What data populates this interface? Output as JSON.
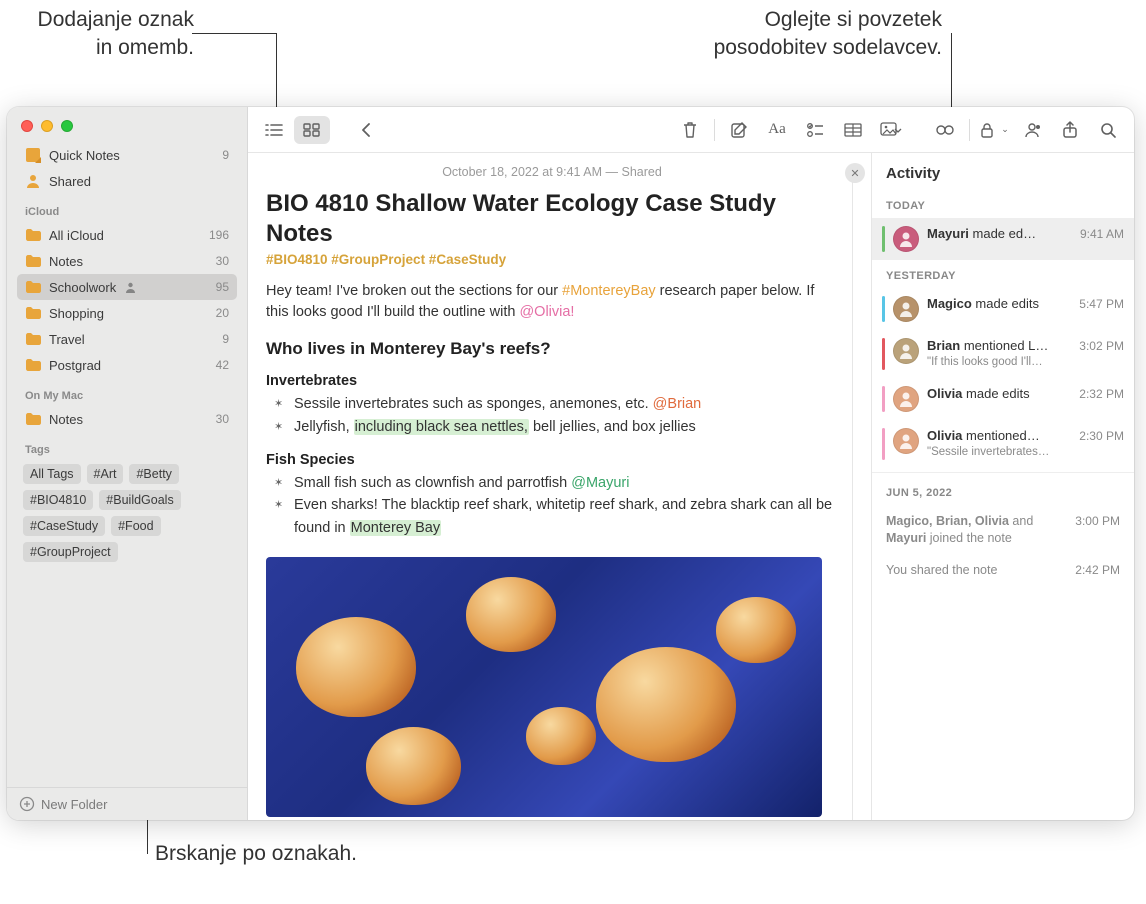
{
  "callouts": {
    "top_left": "Dodajanje oznak\nin omemb.",
    "top_right": "Oglejte si povzetek\nposodobitev sodelavcev.",
    "bottom": "Brskanje po oznakah."
  },
  "sidebar": {
    "top": [
      {
        "icon": "quick",
        "label": "Quick Notes",
        "count": "9"
      },
      {
        "icon": "shared",
        "label": "Shared",
        "count": ""
      }
    ],
    "sections": [
      {
        "title": "iCloud",
        "items": [
          {
            "label": "All iCloud",
            "count": "196",
            "shared": false,
            "selected": false
          },
          {
            "label": "Notes",
            "count": "30",
            "shared": false,
            "selected": false
          },
          {
            "label": "Schoolwork",
            "count": "95",
            "shared": true,
            "selected": true
          },
          {
            "label": "Shopping",
            "count": "20",
            "shared": false,
            "selected": false
          },
          {
            "label": "Travel",
            "count": "9",
            "shared": false,
            "selected": false
          },
          {
            "label": "Postgrad",
            "count": "42",
            "shared": false,
            "selected": false
          }
        ]
      },
      {
        "title": "On My Mac",
        "items": [
          {
            "label": "Notes",
            "count": "30",
            "shared": false,
            "selected": false
          }
        ]
      }
    ],
    "tags_title": "Tags",
    "tags": [
      "All Tags",
      "#Art",
      "#Betty",
      "#BIO4810",
      "#BuildGoals",
      "#CaseStudy",
      "#Food",
      "#GroupProject"
    ],
    "new_folder": "New Folder"
  },
  "note": {
    "date": "October 18, 2022 at 9:41 AM — Shared",
    "title": "BIO 4810 Shallow Water Ecology Case Study Notes",
    "hashtags": "#BIO4810 #GroupProject #CaseStudy",
    "intro_a": "Hey team! I've broken out the sections for our ",
    "intro_tag": "#MontereyBay",
    "intro_b": " research paper below. If this looks good I'll build the outline with ",
    "intro_mention": "@Olivia!",
    "h2": "Who lives in Monterey Bay's reefs?",
    "h3a": "Invertebrates",
    "inv1a": "Sessile invertebrates such as sponges, anemones, etc. ",
    "inv1m": "@Brian",
    "inv2a": "Jellyfish, ",
    "inv2hl": "including black sea nettles,",
    "inv2b": " bell jellies, and box jellies",
    "h3b": "Fish Species",
    "fish1a": "Small fish such as clownfish and parrotfish ",
    "fish1m": "@Mayuri",
    "fish2a": "Even sharks! The blacktip reef shark, whitetip reef shark, and zebra shark can all be found in ",
    "fish2hl": "Monterey Bay"
  },
  "activity": {
    "title": "Activity",
    "today": "TODAY",
    "yesterday": "YESTERDAY",
    "jun5": "JUN 5, 2022",
    "rows": [
      {
        "name": "Mayuri",
        "rest": " made ed…",
        "time": "9:41 AM",
        "color": "#6fbf6f",
        "avatar": "#c95c7c",
        "sub": ""
      },
      {
        "name": "Magico",
        "rest": " made edits",
        "time": "5:47 PM",
        "color": "#58c5e6",
        "avatar": "#b7926a",
        "sub": ""
      },
      {
        "name": "Brian",
        "rest": " mentioned L…",
        "time": "3:02 PM",
        "color": "#e2585f",
        "avatar": "#baa27a",
        "sub": "\"If this looks good I'll…"
      },
      {
        "name": "Olivia",
        "rest": " made edits",
        "time": "2:32 PM",
        "color": "#f29fc3",
        "avatar": "#e0a480",
        "sub": ""
      },
      {
        "name": "Olivia",
        "rest": " mentioned…",
        "time": "2:30 PM",
        "color": "#f29fc3",
        "avatar": "#e0a480",
        "sub": "\"Sessile invertebrates…"
      }
    ],
    "plain": [
      {
        "text_a": "Magico, Brian, Olivia",
        "text_b": " and ",
        "text_c": "Mayuri",
        "text_d": " joined the note",
        "time": "3:00 PM"
      },
      {
        "text": "You shared the note",
        "time": "2:42 PM"
      }
    ]
  }
}
